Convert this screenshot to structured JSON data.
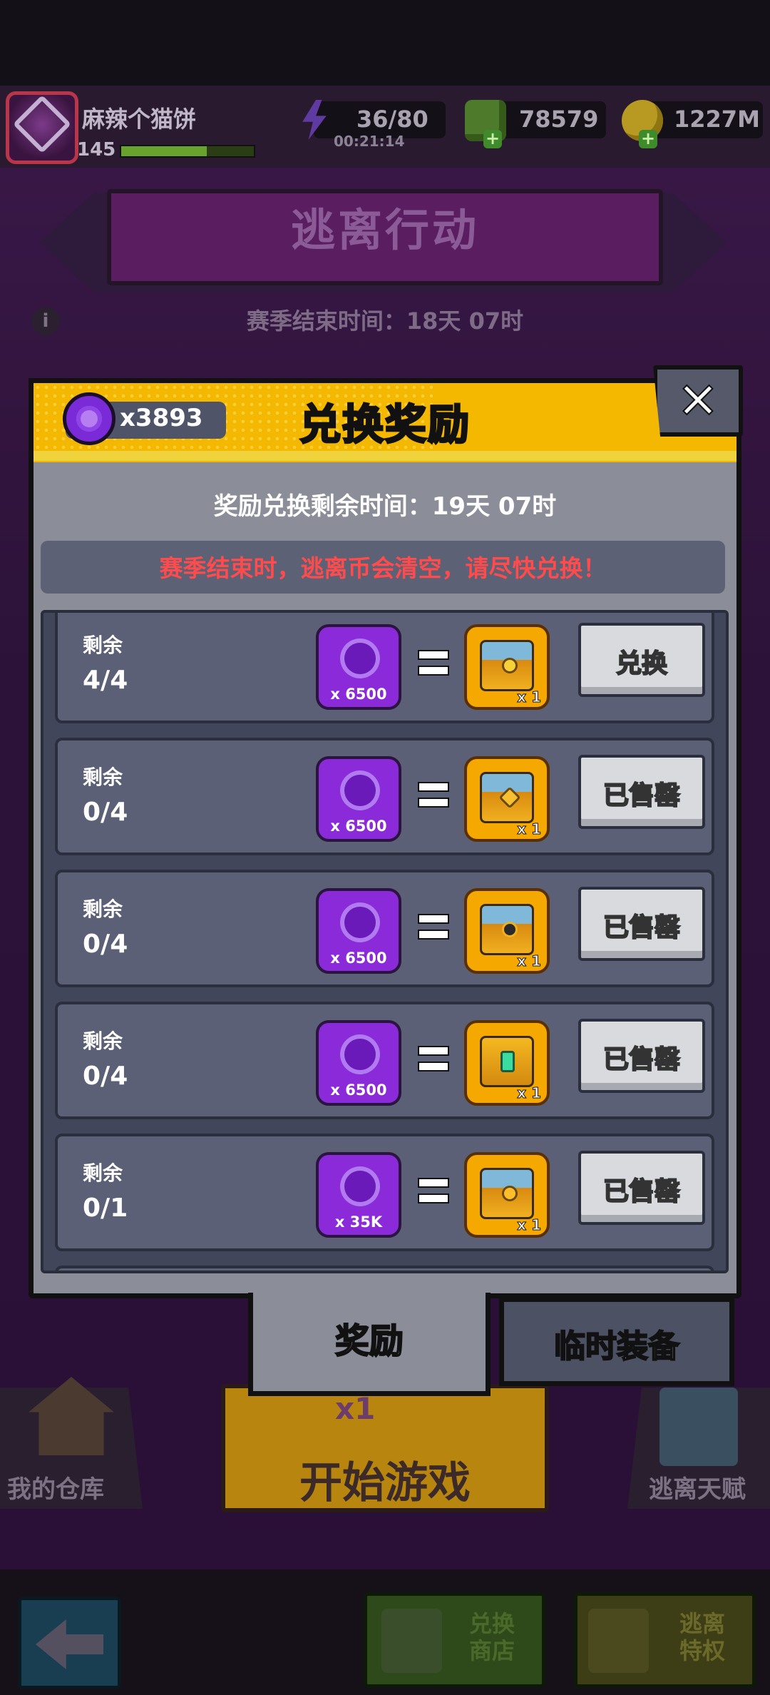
{
  "player": {
    "name": "麻辣个猫饼",
    "level": "145",
    "avatar_badge": "AT8"
  },
  "resources": {
    "energy": "36/80",
    "energy_timer": "00:21:14",
    "cubes": "78579",
    "coins": "1227M"
  },
  "mode": {
    "title": "逃离行动",
    "season_end": "赛季结束时间：18天 07时"
  },
  "modal": {
    "gem_count": "x3893",
    "title": "兑换奖励",
    "close_glyph": "✕",
    "remaining_time": "奖励兑换剩余时间：19天 07时",
    "notice": "赛季结束时，逃离币会清空，请尽快兑换！",
    "rows": [
      {
        "remain_label": "剩余",
        "remain": "4/4",
        "cost": "x 6500",
        "reward_qty": "x 1",
        "button": "兑换"
      },
      {
        "remain_label": "剩余",
        "remain": "0/4",
        "cost": "x 6500",
        "reward_qty": "x 1",
        "button": "已售罄"
      },
      {
        "remain_label": "剩余",
        "remain": "0/4",
        "cost": "x 6500",
        "reward_qty": "x 1",
        "button": "已售罄"
      },
      {
        "remain_label": "剩余",
        "remain": "0/4",
        "cost": "x 6500",
        "reward_qty": "x 1",
        "button": "已售罄"
      },
      {
        "remain_label": "剩余",
        "remain": "0/1",
        "cost": "x 35K",
        "reward_qty": "x 1",
        "button": "已售罄"
      }
    ],
    "tabs": {
      "rewards": "奖励",
      "temp_equipment": "临时装备"
    }
  },
  "background_buttons": {
    "start_energy": "x1",
    "start": "开始游戏",
    "warehouse": "我的仓库",
    "talent": "逃离天赋"
  },
  "bottom_nav": {
    "shop_line1": "兑换",
    "shop_line2": "商店",
    "privilege_line1": "逃离",
    "privilege_line2": "特权"
  },
  "colors": {
    "modal_header": "#f5b800",
    "notice_red": "#ff4b4b",
    "gem_purple": "#8a2ad8",
    "reward_gold": "#f5a800"
  }
}
